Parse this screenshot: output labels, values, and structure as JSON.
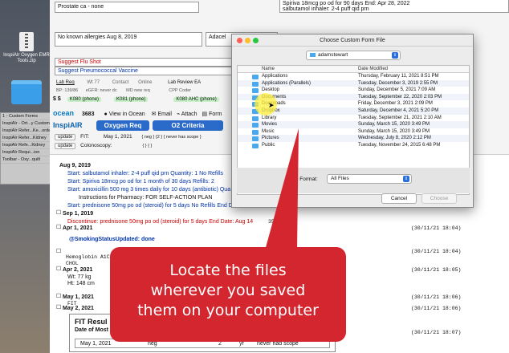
{
  "desktop": {
    "zip_label": "InspiAIr Oxygen EMR Tools.zip",
    "panel_items": [
      "1 - Custom Forms",
      "InspiAIr - Ort...y Custom",
      "InspiAIr Refer...Ke...order",
      "InspiAIr Refer...Kidney",
      "InspiAIr Refe...Kidney",
      "InspiAIr Requi...ion",
      "Toolbar - Oxy...quilt"
    ]
  },
  "app": {
    "problem": "Prostate ca - none",
    "med1": "Spiriva 18mcg po od for 90 days   End: Apr 28, 2022",
    "med2": "salbutamol inhaler: 2-4 puff qid prn",
    "allergies": "No known allergies Aug 8, 2019",
    "adacel": "Adacel",
    "flu": "Suggest Flu Shot",
    "pneumo": "Suggest Pneumococcal Vaccine",
    "lab_req": "Lab Req",
    "wt": "Wt 77",
    "contact": "Contact",
    "online": "Online",
    "lab_review": "Lab Review EA",
    "bp": "BP: 139/86",
    "egfr": "eGFR: never dc",
    "md_new": "MD new req",
    "cpp": "CPP Coder",
    "ss": "$ $",
    "k080": "K080 (phone)",
    "k081": "K081 (phone)",
    "k080ahc": "K080 AHC (phone)",
    "ocean": "ocean",
    "num": "3683",
    "view_ocean": "View in Ocean",
    "email": "Email",
    "attach": "Attach",
    "form": "Form",
    "inspiair": "InspiAIR",
    "oxygen_req": "Oxygen Req",
    "o2_criteria": "O2 Criteria",
    "update1": "update",
    "fit_label": "FIT:",
    "fit_date": "May 1, 2021",
    "fit_rest": "{ neg }     {2 }   { never has scope }",
    "update2": "update",
    "colon_label": "Colonoscopy:",
    "colon_rest": "{ }     { }",
    "n1_date": "Aug 9, 2019",
    "n1_l1": "Start: salbutamol inhaler: 2-4 puff qid prn Quantity: 1   No Refills",
    "n1_l2": "Start: Spiriva 18mcg po od for 1 month of 30 days Refills: 2",
    "n1_l3": "Start: amoxicillin 500 mg 3 times daily for 10 days (antibiotic) Qua",
    "n1_l4": "Instructions for Pharmacy: FOR SELF-ACTION PLAN",
    "n1_l5": "Start: prednisone 50mg po od (steroid) for 5 days No Refills End Dat",
    "n2_date": "Sep 1, 2019",
    "n2_l1": "Discontinue: prednisone 50mg po od (steroid) for 5 days End Date: Aug 14",
    "n3_date": "Apr 1, 2021",
    "n3_l1": "@SmokingStatusUpdated: done",
    "n4_l1": "Hemoglobin A1C",
    "n4_l2": "CHOL",
    "n5_date": "Apr 2, 2021",
    "n5_l1": "Wt: 77 kg",
    "n5_l2": "Ht: 148 cm",
    "n6_date": "May 1, 2021",
    "n6_l1": "FIT",
    "n7_date": "May 2, 2021",
    "ts1": "(30/11/21 18:04)",
    "ts2": "(30/11/21 18:04)",
    "ts3": "(30/11/21 18:05)",
    "ts4": "(30/11/21 18:06)",
    "ts5": "(30/11/21 18:06)",
    "ts6": "(30/11/21 18:07)",
    "ts7": "35",
    "fit_box_title": "FIT Resul",
    "fit_box_sub": "Date of Most",
    "fit_tbl": [
      "May 1, 2021",
      "neg",
      "2",
      "yr",
      "never had scope"
    ],
    "partial_p": "P"
  },
  "dialog": {
    "title": "Choose Custom Form File",
    "location": "adamstewart",
    "col_name": "Name",
    "col_date": "Date Modified",
    "files": [
      {
        "name": "Applications",
        "date": "Thursday, February 11, 2021 8:51 PM"
      },
      {
        "name": "Applications (Parallels)",
        "date": "Tuesday, December 3, 2019 2:55 PM"
      },
      {
        "name": "Desktop",
        "date": "Sunday, December 5, 2021 7:09 AM"
      },
      {
        "name": "Documents",
        "date": "Tuesday, September 22, 2020 2:03 PM"
      },
      {
        "name": "Downloads",
        "date": "Friday, December 3, 2021 2:09 PM"
      },
      {
        "name": "Dropbox",
        "date": "Saturday, December 4, 2021 5:20 PM"
      },
      {
        "name": "Library",
        "date": "Tuesday, September 21, 2021 2:10 AM"
      },
      {
        "name": "Movies",
        "date": "Sunday, March 15, 2020 3:49 PM"
      },
      {
        "name": "Music",
        "date": "Sunday, March 15, 2020 3:49 PM"
      },
      {
        "name": "Pictures",
        "date": "Wednesday, July 8, 2020 2:12 PM"
      },
      {
        "name": "Public",
        "date": "Tuesday, November 24, 2015 6:48 PM"
      }
    ],
    "format_label": "File Format:",
    "format_value": "All Files",
    "cancel": "Cancel",
    "choose": "Choose",
    "left_strip": [
      "F",
      "2",
      "2",
      "2",
      "2",
      "2",
      "2",
      "2",
      "2",
      "2",
      "2",
      "2",
      "A",
      "A",
      "A",
      "A",
      "A",
      "A",
      "A"
    ]
  },
  "callout": {
    "line1": "Locate the files",
    "line2": "wherever you saved",
    "line3": "them on your computer"
  }
}
